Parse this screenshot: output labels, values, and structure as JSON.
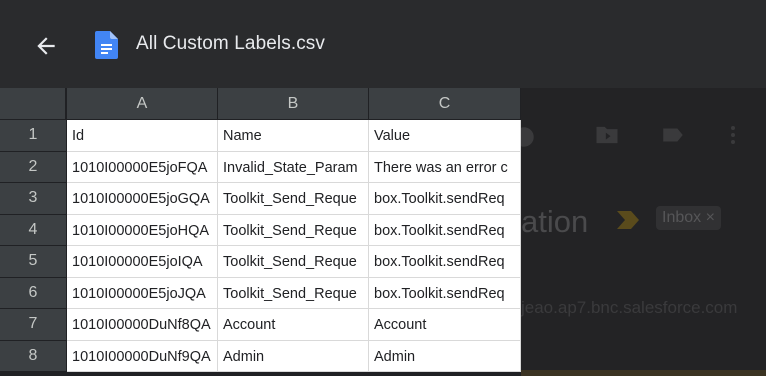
{
  "header": {
    "title": "All Custom Labels.csv",
    "back_icon": "arrow-back-icon",
    "file_icon": "google-docs-icon",
    "file_icon_color": "#4285f4"
  },
  "sheet": {
    "columns": [
      "A",
      "B",
      "C"
    ],
    "rows": [
      {
        "num": "1",
        "cells": [
          "Id",
          "Name",
          "Value"
        ]
      },
      {
        "num": "2",
        "cells": [
          "1010I00000E5joFQA",
          "Invalid_State_Param",
          "There was an error c"
        ]
      },
      {
        "num": "3",
        "cells": [
          "1010I00000E5joGQA",
          "Toolkit_Send_Reque",
          "box.Toolkit.sendReq"
        ]
      },
      {
        "num": "4",
        "cells": [
          "1010I00000E5joHQA",
          "Toolkit_Send_Reque",
          "box.Toolkit.sendReq"
        ]
      },
      {
        "num": "5",
        "cells": [
          "1010I00000E5joIQA",
          "Toolkit_Send_Reque",
          "box.Toolkit.sendReq"
        ]
      },
      {
        "num": "6",
        "cells": [
          "1010I00000E5joJQA",
          "Toolkit_Send_Reque",
          "box.Toolkit.sendReq"
        ]
      },
      {
        "num": "7",
        "cells": [
          "1010I00000DuNf8QA",
          "Account",
          "Account"
        ]
      },
      {
        "num": "8",
        "cells": [
          "1010I00000DuNf9QA",
          "Admin",
          "Admin"
        ]
      }
    ]
  },
  "background": {
    "subject_fragment": "ation",
    "inbox_chip": "Inbox",
    "inbox_close": "×",
    "link_fragment": "jeao.ap7.bnc.salesforce.com"
  }
}
